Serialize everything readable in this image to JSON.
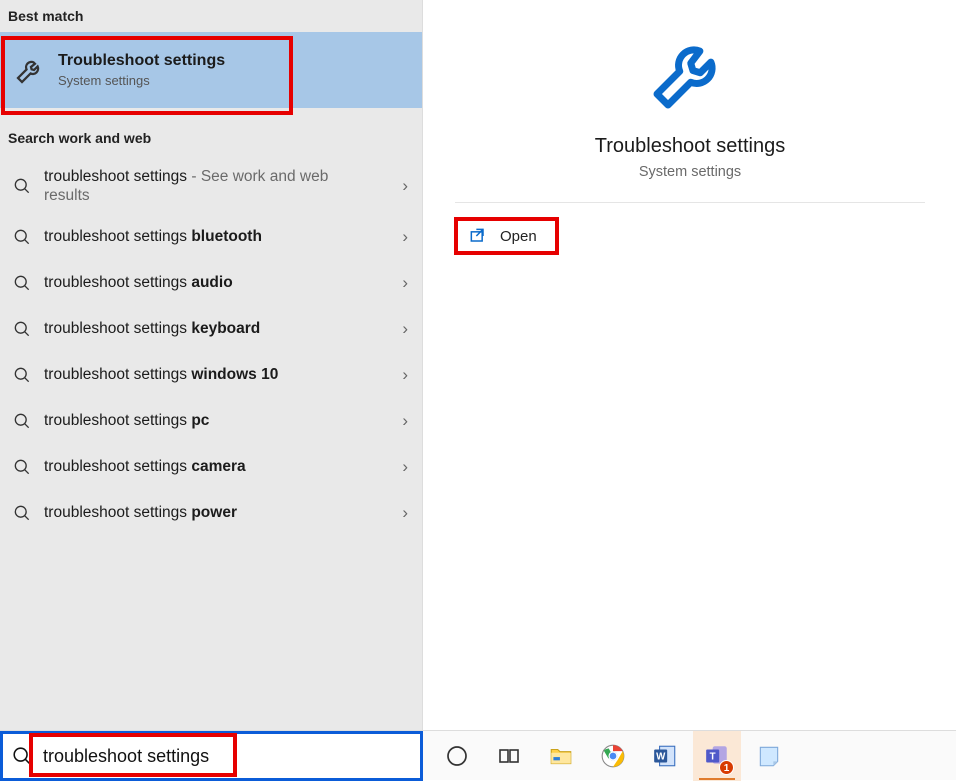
{
  "left": {
    "section_best_match": "Best match",
    "best_match": {
      "title": "Troubleshoot settings",
      "subtitle": "System settings"
    },
    "section_search": "Search work and web",
    "suggestions": [
      {
        "prefix": "troubleshoot settings",
        "bold": "",
        "suffix": " - See work and web results"
      },
      {
        "prefix": "troubleshoot settings ",
        "bold": "bluetooth",
        "suffix": ""
      },
      {
        "prefix": "troubleshoot settings ",
        "bold": "audio",
        "suffix": ""
      },
      {
        "prefix": "troubleshoot settings ",
        "bold": "keyboard",
        "suffix": ""
      },
      {
        "prefix": "troubleshoot settings ",
        "bold": "windows 10",
        "suffix": ""
      },
      {
        "prefix": "troubleshoot settings ",
        "bold": "pc",
        "suffix": ""
      },
      {
        "prefix": "troubleshoot settings ",
        "bold": "camera",
        "suffix": ""
      },
      {
        "prefix": "troubleshoot settings ",
        "bold": "power",
        "suffix": ""
      }
    ]
  },
  "preview": {
    "title": "Troubleshoot settings",
    "subtitle": "System settings",
    "action_open": "Open"
  },
  "taskbar": {
    "search_value": "troubleshoot settings",
    "icons": {
      "cortana": "cortana",
      "taskview": "task-view",
      "explorer": "file-explorer",
      "chrome": "chrome",
      "word": "word",
      "teams": "teams",
      "teams_badge": "1",
      "notes": "sticky-notes"
    }
  }
}
